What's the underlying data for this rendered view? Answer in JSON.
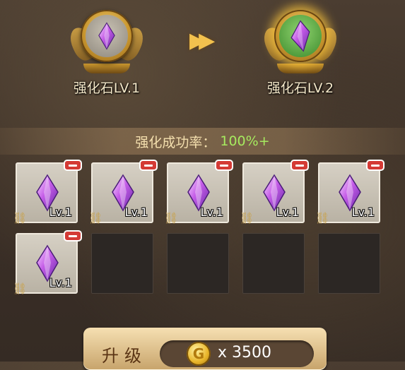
{
  "current_stone": {
    "label": "强化石LV.1",
    "icon": "purple-crystal-icon"
  },
  "next_stone": {
    "label": "强化石LV.2",
    "icon": "purple-crystal-icon"
  },
  "transition_icon": "double-chevron-right-icon",
  "success_rate": {
    "label": "强化成功率：",
    "value": "100%+"
  },
  "material_slots": [
    {
      "filled": true,
      "level": "Lv.1"
    },
    {
      "filled": true,
      "level": "Lv.1"
    },
    {
      "filled": true,
      "level": "Lv.1"
    },
    {
      "filled": true,
      "level": "Lv.1"
    },
    {
      "filled": true,
      "level": "Lv.1"
    },
    {
      "filled": true,
      "level": "Lv.1"
    },
    {
      "filled": false
    },
    {
      "filled": false
    },
    {
      "filled": false
    },
    {
      "filled": false
    }
  ],
  "upgrade": {
    "label": "升级",
    "cost_prefix": "x",
    "cost": "3500",
    "currency_icon": "gold-coin-icon",
    "coin_letter": "G"
  },
  "colors": {
    "success_value": "#a6ea5f",
    "remove_badge": "#d43a35",
    "gold": "#e8b52a"
  }
}
